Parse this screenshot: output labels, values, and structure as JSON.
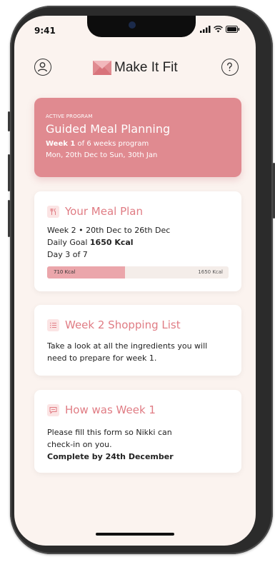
{
  "status": {
    "time": "9:41"
  },
  "header": {
    "brand": "Make It Fit",
    "profile_icon": "user-icon",
    "help_icon": "help-icon"
  },
  "program": {
    "tag": "ACTIVE PROGRAM",
    "title": "Guided Meal Planning",
    "week_current": "Week 1",
    "week_rest": " of 6 weeks program",
    "dates": "Mon, 20th Dec to Sun, 30th Jan"
  },
  "meal_plan": {
    "title": "Your Meal Plan",
    "week_line": "Week 2 • 20th Dec to 26th Dec",
    "goal_prefix": "Daily Goal ",
    "goal_value": "1650 Kcal",
    "day_line": "Day 3 of 7",
    "progress_current": "710 Kcal",
    "progress_target": "1650 Kcal",
    "progress_fraction": 0.43
  },
  "shopping": {
    "title": "Week 2 Shopping List",
    "line1": "Take a look at all the ingredients you will",
    "line2": "need to prepare for week 1."
  },
  "feedback": {
    "title": "How was Week 1",
    "line1": "Please fill this form so Nikki can",
    "line2": "check-in on you.",
    "deadline": "Complete by 24th December"
  },
  "colors": {
    "accent": "#e08a90",
    "title_pink": "#e07c84",
    "background": "#fbf3ef"
  }
}
